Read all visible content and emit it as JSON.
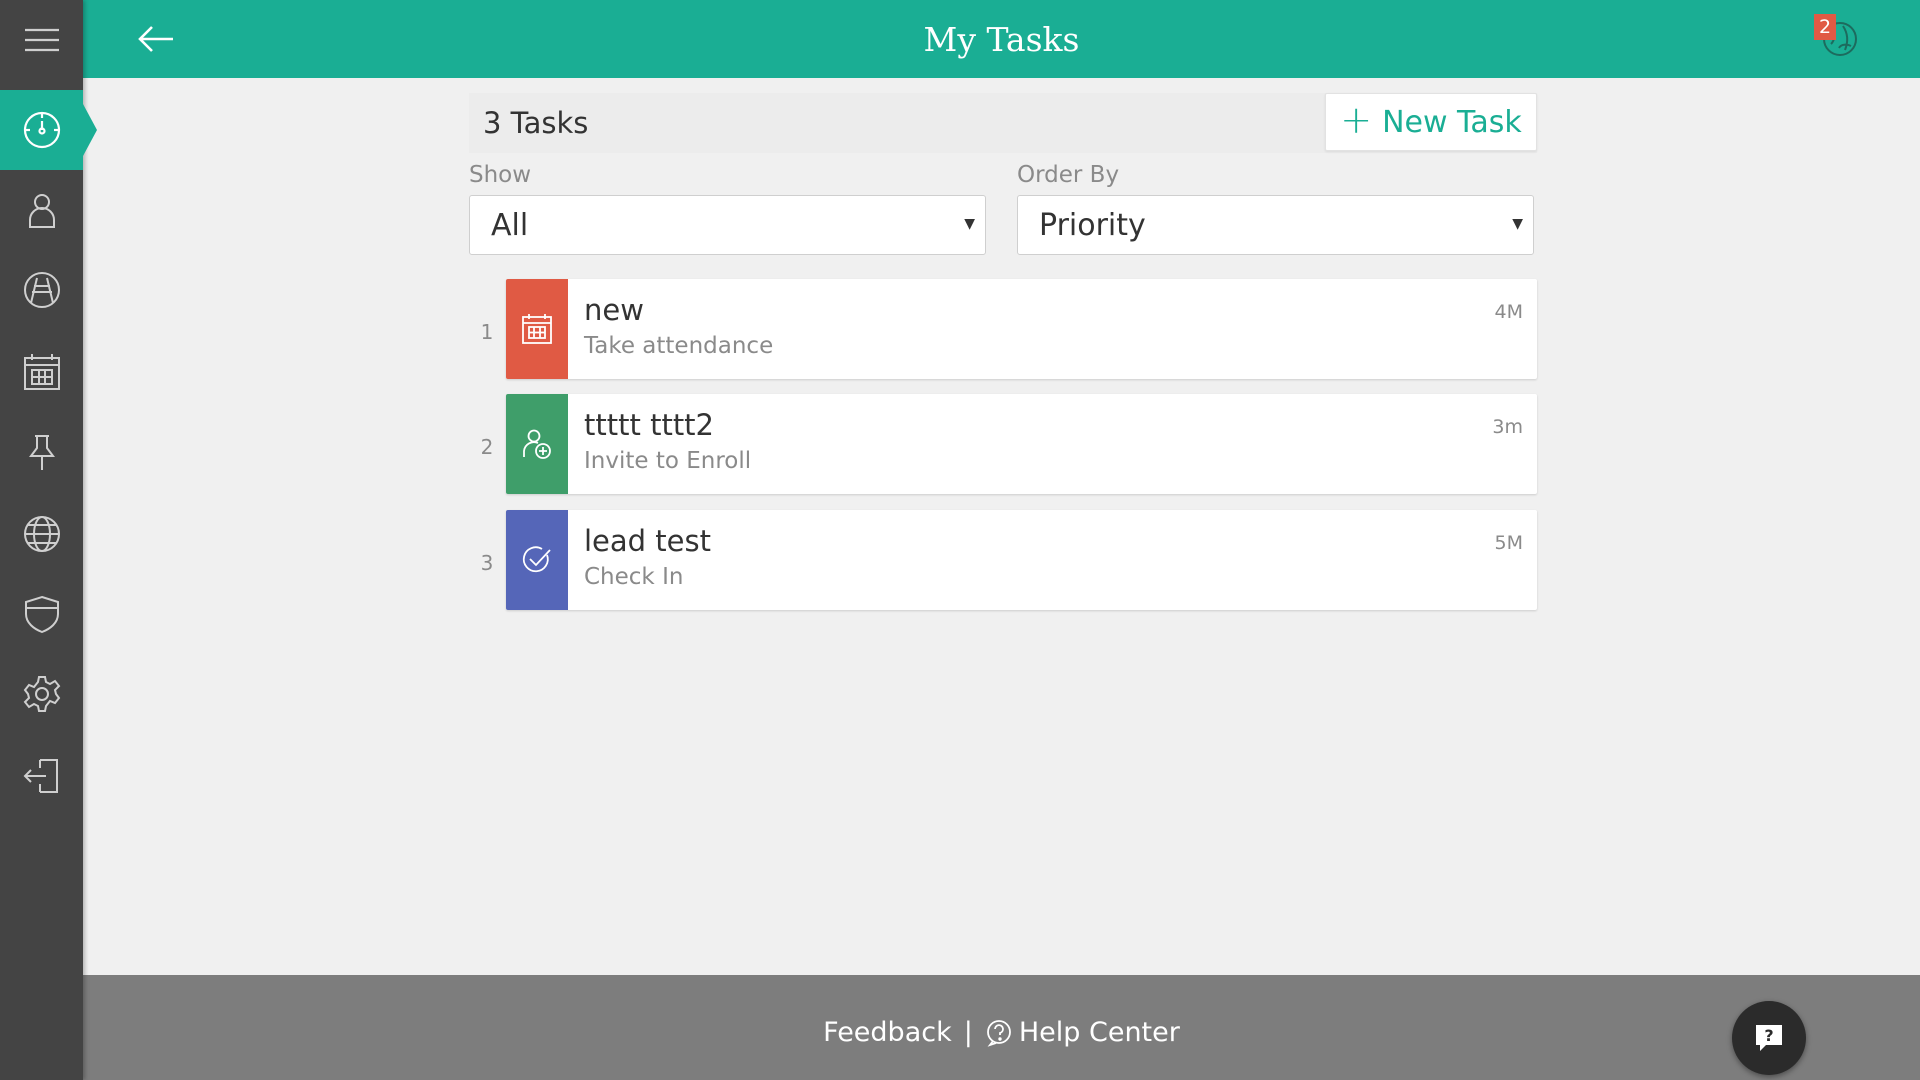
{
  "header": {
    "title": "My Tasks",
    "notification_count": "2"
  },
  "sidebar": {
    "items": [
      {
        "name": "dashboard",
        "icon": "dashboard-gauge-icon",
        "active": true
      },
      {
        "name": "people",
        "icon": "person-icon"
      },
      {
        "name": "programs",
        "icon": "road-icon"
      },
      {
        "name": "calendar",
        "icon": "calendar-icon"
      },
      {
        "name": "pins",
        "icon": "pushpin-icon"
      },
      {
        "name": "web",
        "icon": "globe-icon"
      },
      {
        "name": "security",
        "icon": "shield-icon"
      },
      {
        "name": "settings",
        "icon": "gear-icon"
      },
      {
        "name": "logout",
        "icon": "logout-icon"
      }
    ]
  },
  "tasks_header": {
    "count_label": "3 Tasks",
    "new_task_label": "New Task"
  },
  "filters": {
    "show_label": "Show",
    "show_value": "All",
    "order_label": "Order By",
    "order_value": "Priority"
  },
  "tasks": [
    {
      "number": "1",
      "title": "new",
      "subtitle": "Take attendance",
      "time": "4M",
      "color": "#e05a44",
      "icon": "calendar-grid-icon"
    },
    {
      "number": "2",
      "title": "ttttt tttt2",
      "subtitle": "Invite to Enroll",
      "time": "3m",
      "color": "#3f9e6a",
      "icon": "person-add-icon"
    },
    {
      "number": "3",
      "title": "lead test",
      "subtitle": "Check In",
      "time": "5M",
      "color": "#5566b8",
      "icon": "check-circle-icon"
    }
  ],
  "footer": {
    "feedback_label": "Feedback",
    "separator": "|",
    "help_label": "Help Center"
  },
  "colors": {
    "accent": "#1aae94",
    "sidebar": "#444444",
    "footer": "#7d7d7d"
  }
}
